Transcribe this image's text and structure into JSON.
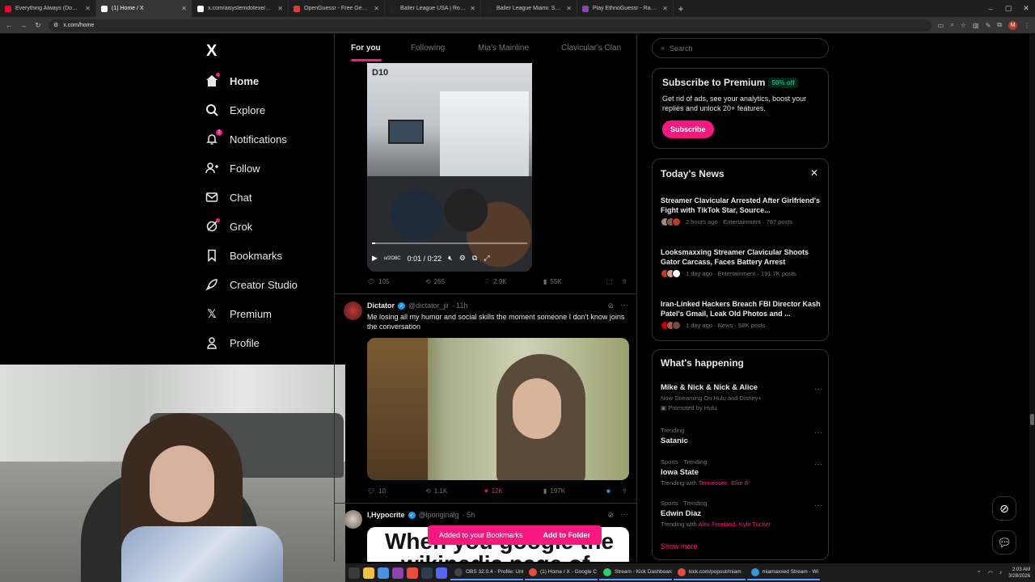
{
  "browser": {
    "tabs": [
      {
        "title": "Everything Always (Dom Di",
        "color": "#ff0033"
      },
      {
        "title": "(1) Home / X",
        "color": "#ffffff",
        "active": true
      },
      {
        "title": "x.com/aisystemdotexe/status/2",
        "color": "#ffffff"
      },
      {
        "title": "OpenGuessr - Free GeoGu",
        "color": "#e53935"
      },
      {
        "title": "Baller League USA | Ronaldinh",
        "color": "#222222"
      },
      {
        "title": "Baller League Miami: Season 1",
        "color": "#222222"
      },
      {
        "title": "Play EthnoGuessr - Race Guess",
        "color": "#8e44ad"
      }
    ],
    "url": "x.com/home",
    "profile_initial": "M"
  },
  "nav": {
    "logo": "X",
    "items": [
      {
        "label": "Home",
        "icon": "home-icon"
      },
      {
        "label": "Explore",
        "icon": "search-icon"
      },
      {
        "label": "Notifications",
        "icon": "bell-icon",
        "badge": "1"
      },
      {
        "label": "Follow",
        "icon": "add-person-icon"
      },
      {
        "label": "Chat",
        "icon": "mail-icon"
      },
      {
        "label": "Grok",
        "icon": "grok-icon"
      },
      {
        "label": "Bookmarks",
        "icon": "bookmark-icon"
      },
      {
        "label": "Creator Studio",
        "icon": "rocket-icon"
      },
      {
        "label": "Premium",
        "icon": "x-icon"
      },
      {
        "label": "Profile",
        "icon": "person-icon"
      }
    ]
  },
  "feed_tabs": [
    "For you",
    "Following",
    "Mia's Mainline",
    "Clavicular's Clan"
  ],
  "tweet1": {
    "video_time": "0:01 / 0:22",
    "video_label": "D10",
    "video_progress": 0.02,
    "watermark": "u/2O8C",
    "replies": "105",
    "reposts": "265",
    "likes": "2.9K",
    "views": "55K"
  },
  "tweet2": {
    "name": "Dictator",
    "handle": "@dictator_jii",
    "time": "· 11h",
    "text": "Me losing all my humor and social skills the moment someone I don't know joins the conversation",
    "replies": "10",
    "reposts": "1.1K",
    "likes": "12K",
    "views": "197K"
  },
  "tweet3": {
    "name": "l,Hypocrite",
    "handle": "@lporiginalg",
    "time": "· 5h",
    "image_text": "When you google the",
    "image_text2": "wikipedia page of"
  },
  "toast": {
    "message": "Added to your Bookmarks",
    "action": "Add to Folder"
  },
  "right": {
    "search_placeholder": "Search",
    "premium": {
      "title": "Subscribe to Premium",
      "pill": "50% off",
      "text": "Get rid of ads, see your analytics, boost your replies and unlock 20+ features.",
      "button": "Subscribe"
    },
    "news": {
      "title": "Today's News",
      "items": [
        {
          "title": "Streamer Clavicular Arrested After Girlfriend's Fight with TikTok Star, Source...",
          "meta": "2 hours ago · Entertainment · 787 posts"
        },
        {
          "title": "Looksmaxxing Streamer Clavicular Shoots Gator Carcass, Faces Battery Arrest",
          "meta": "1 day ago · Entertainment · 191.7K posts"
        },
        {
          "title": "Iran-Linked Hackers Breach FBI Director Kash Patel's Gmail, Leak Old Photos and ...",
          "meta": "1 day ago · News · 58K posts"
        }
      ]
    },
    "happening": {
      "title": "What's happening",
      "items": [
        {
          "ctx": "",
          "title": "Mike & Nick & Nick & Alice",
          "sub": "Now Streaming On Hulu and Disney+",
          "promo": "Promoted by Hulu"
        },
        {
          "ctx": "Trending",
          "title": "Satanic",
          "sub": ""
        },
        {
          "ctx": "Sports · Trending",
          "title": "Iowa State",
          "sub": "Trending with",
          "links": "Tennessee, Elite 8"
        },
        {
          "ctx": "Sports · Trending",
          "title": "Edwin Diaz",
          "sub": "Trending with",
          "links": "Alex Freeland, Kyle Tucker"
        }
      ],
      "show_more": "Show more"
    }
  },
  "taskbar": {
    "items": [
      {
        "label": "OBS 32.0.4 - Profile: Unt",
        "color": "#444444"
      },
      {
        "label": "(1) Home / X - Google C",
        "color": "#e74c3c"
      },
      {
        "label": "Stream - Kick Dashboard",
        "color": "#2ecc71"
      },
      {
        "label": "kick.com/popout/miam",
        "color": "#e74c3c"
      },
      {
        "label": "miamaxxed Stream - Wi",
        "color": "#3498db"
      }
    ],
    "time": "2:03 AM",
    "date": "3/28/2026"
  }
}
